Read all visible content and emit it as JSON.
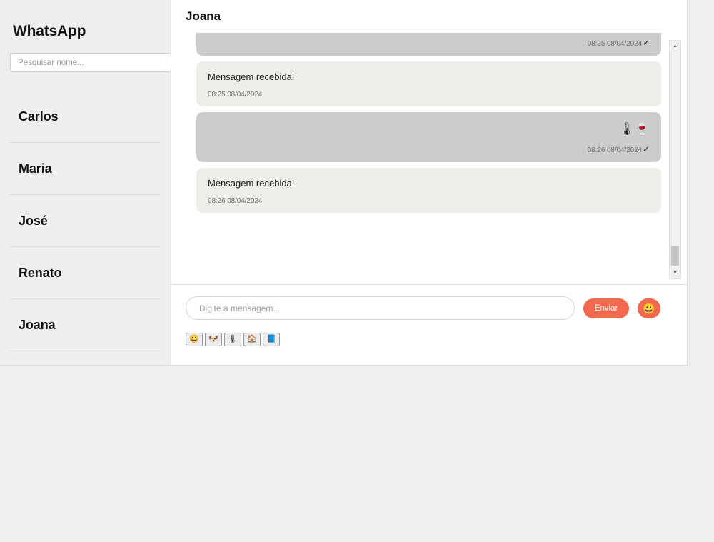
{
  "app": {
    "brand_title": "WhatsApp",
    "accent_color": "#F4684D",
    "sidebar_bg": "#EEEEEE",
    "sent_bubble_color": "#CCCCCC",
    "received_bubble_color": "#ECEFE8"
  },
  "sidebar": {
    "search": {
      "placeholder": "Pesquisar nome...",
      "value": ""
    },
    "contacts": [
      {
        "name": "Carlos"
      },
      {
        "name": "Maria"
      },
      {
        "name": "José"
      },
      {
        "name": "Renato"
      },
      {
        "name": "Joana"
      }
    ]
  },
  "chat": {
    "title": "Joana",
    "messages": [
      {
        "direction": "sent",
        "text": "▢",
        "timestamp": "08:25 08/04/2024",
        "tick": "✓"
      },
      {
        "direction": "received",
        "text": "Mensagem recebida!",
        "timestamp": "08:25 08/04/2024",
        "tick": ""
      },
      {
        "direction": "sent",
        "text": "🌡🍷",
        "timestamp": "08:26 08/04/2024",
        "tick": "✓"
      },
      {
        "direction": "received",
        "text": "Mensagem recebida!",
        "timestamp": "08:26 08/04/2024",
        "tick": ""
      }
    ],
    "scrollbar": {
      "up_arrow": "▲",
      "down_arrow": "▼"
    }
  },
  "composer": {
    "input": {
      "placeholder": "Digite a mensagem...",
      "value": ""
    },
    "send_label": "Enviar",
    "emoji_toggle_glyph": "😀",
    "emoji_palette": [
      {
        "glyph": "😀",
        "name": "grinning-face-emoji"
      },
      {
        "glyph": "🐶",
        "name": "dog-face-emoji"
      },
      {
        "glyph": "🌡",
        "name": "thermometer-emoji"
      },
      {
        "glyph": "🏠",
        "name": "house-emoji"
      },
      {
        "glyph": "📘",
        "name": "blue-book-emoji"
      }
    ]
  }
}
